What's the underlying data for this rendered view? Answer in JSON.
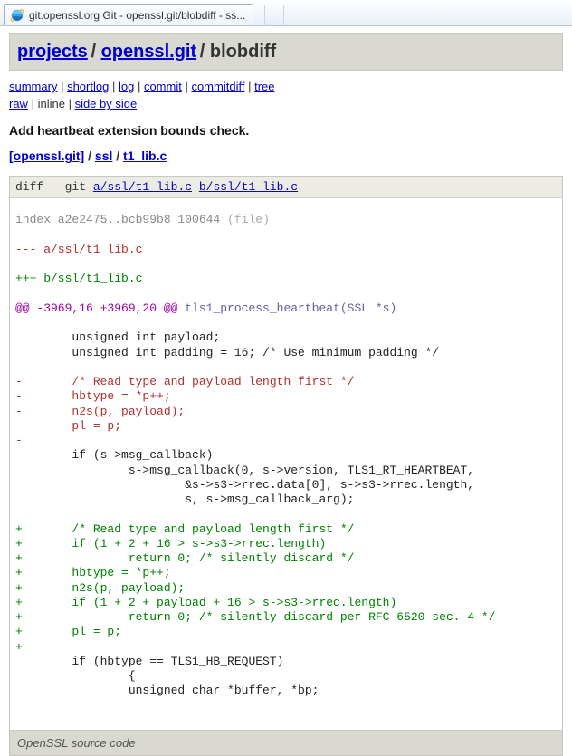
{
  "tab": {
    "title": "git.openssl.org Git - openssl.git/blobdiff - ss..."
  },
  "header": {
    "projects": "projects",
    "repo": "openssl.git",
    "action": "blobdiff"
  },
  "nav": {
    "line1": {
      "summary": "summary",
      "shortlog": "shortlog",
      "log": "log",
      "commit": "commit",
      "commitdiff": "commitdiff",
      "tree": "tree"
    },
    "line2": {
      "raw": "raw",
      "inline": "inline",
      "sbs": "side by side"
    }
  },
  "commit_title": "Add heartbeat extension bounds check.",
  "path": {
    "p0": "[openssl.git]",
    "p1": "ssl",
    "p2": "t1_lib.c"
  },
  "diff": {
    "header_prefix": "diff --git ",
    "file_a": "a/ssl/t1_lib.c",
    "file_b": "b/ssl/t1_lib.c",
    "index": "index a2e2475..bcb99b8 100644",
    "index_tag": "(file)",
    "minus": "--- a/ssl/t1_lib.c",
    "plus": "+++ b/ssl/t1_lib.c",
    "hunk_range": "@@ -3969,16 +3969,20 @@",
    "hunk_fn": " tls1_process_heartbeat(SSL *s)",
    "lines": [
      {
        "cls": "ctx",
        "t": "        unsigned int payload;"
      },
      {
        "cls": "ctx",
        "t": "        unsigned int padding = 16; /* Use minimum padding */"
      },
      {
        "cls": "ctx",
        "t": " "
      },
      {
        "cls": "del",
        "t": "-       /* Read type and payload length first */"
      },
      {
        "cls": "del",
        "t": "-       hbtype = *p++;"
      },
      {
        "cls": "del",
        "t": "-       n2s(p, payload);"
      },
      {
        "cls": "del",
        "t": "-       pl = p;"
      },
      {
        "cls": "del",
        "t": "-"
      },
      {
        "cls": "ctx",
        "t": "        if (s->msg_callback)"
      },
      {
        "cls": "ctx",
        "t": "                s->msg_callback(0, s->version, TLS1_RT_HEARTBEAT,"
      },
      {
        "cls": "ctx",
        "t": "                        &s->s3->rrec.data[0], s->s3->rrec.length,"
      },
      {
        "cls": "ctx",
        "t": "                        s, s->msg_callback_arg);"
      },
      {
        "cls": "ctx",
        "t": " "
      },
      {
        "cls": "add",
        "t": "+       /* Read type and payload length first */"
      },
      {
        "cls": "add",
        "t": "+       if (1 + 2 + 16 > s->s3->rrec.length)"
      },
      {
        "cls": "add",
        "t": "+               return 0; /* silently discard */"
      },
      {
        "cls": "add",
        "t": "+       hbtype = *p++;"
      },
      {
        "cls": "add",
        "t": "+       n2s(p, payload);"
      },
      {
        "cls": "add",
        "t": "+       if (1 + 2 + payload + 16 > s->s3->rrec.length)"
      },
      {
        "cls": "add",
        "t": "+               return 0; /* silently discard per RFC 6520 sec. 4 */"
      },
      {
        "cls": "add",
        "t": "+       pl = p;"
      },
      {
        "cls": "add",
        "t": "+"
      },
      {
        "cls": "ctx",
        "t": "        if (hbtype == TLS1_HB_REQUEST)"
      },
      {
        "cls": "ctx",
        "t": "                {"
      },
      {
        "cls": "ctx",
        "t": "                unsigned char *buffer, *bp;"
      }
    ]
  },
  "footer": "OpenSSL source code"
}
